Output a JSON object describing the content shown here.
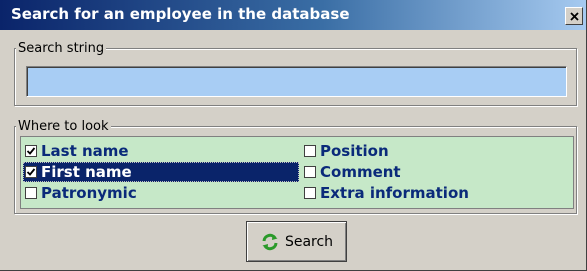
{
  "window": {
    "title": "Search for an employee in the database",
    "close_glyph": "×"
  },
  "search_group": {
    "legend": "Search string",
    "input_value": "",
    "input_placeholder": ""
  },
  "where_group": {
    "legend": "Where to look",
    "options": [
      {
        "label": "Last name",
        "checked": true,
        "selected": false
      },
      {
        "label": "First name",
        "checked": true,
        "selected": true
      },
      {
        "label": "Patronymic",
        "checked": false,
        "selected": false
      },
      {
        "label": "Position",
        "checked": false,
        "selected": false
      },
      {
        "label": "Comment",
        "checked": false,
        "selected": false
      },
      {
        "label": "Extra information",
        "checked": false,
        "selected": false
      }
    ]
  },
  "search_button": {
    "label": "Search",
    "icon": "refresh-icon"
  },
  "colors": {
    "title_bar_start": "#0a246a",
    "title_bar_end": "#a6caf0",
    "input_background": "#a8cdf4",
    "options_background": "#c6e8c8",
    "option_text": "#0a2a7a",
    "selection_highlight": "#0a246a"
  }
}
